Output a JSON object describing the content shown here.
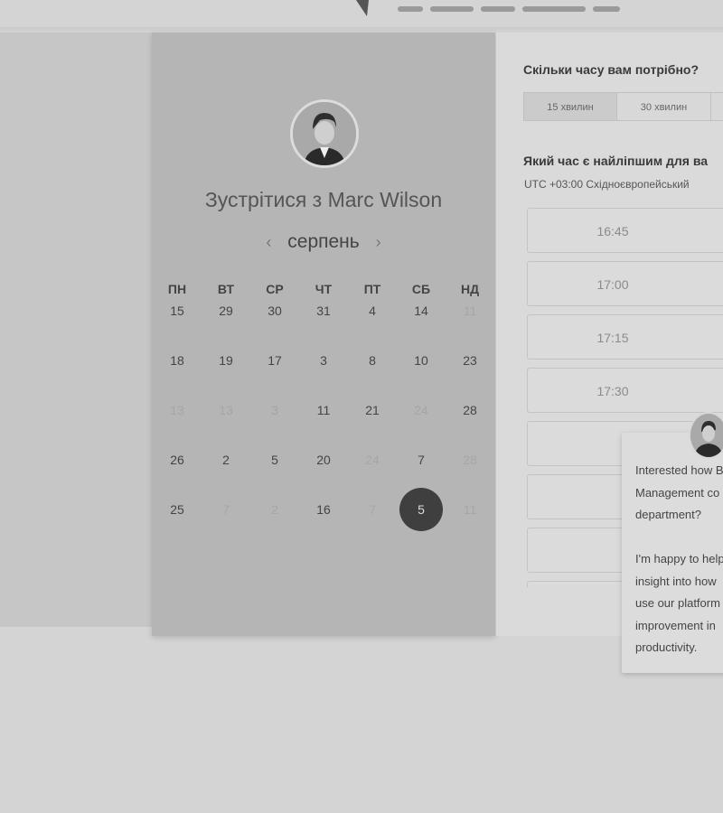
{
  "booking": {
    "title": "Зустрітися з Marc Wilson",
    "calendar": {
      "month": "серпень",
      "weekdays": [
        "ПН",
        "ВТ",
        "СР",
        "ЧТ",
        "ПТ",
        "СБ",
        "НД"
      ],
      "rows": [
        [
          {
            "n": "15"
          },
          {
            "n": "29"
          },
          {
            "n": "30"
          },
          {
            "n": "31"
          },
          {
            "n": "4"
          },
          {
            "n": "14"
          },
          {
            "n": "11",
            "muted": true
          }
        ],
        [
          {
            "n": "18"
          },
          {
            "n": "19"
          },
          {
            "n": "17"
          },
          {
            "n": "3"
          },
          {
            "n": "8"
          },
          {
            "n": "10"
          },
          {
            "n": "23"
          }
        ],
        [
          {
            "n": "13",
            "muted": true
          },
          {
            "n": "13",
            "muted": true
          },
          {
            "n": "3",
            "muted": true
          },
          {
            "n": "11"
          },
          {
            "n": "21"
          },
          {
            "n": "24",
            "muted": true
          },
          {
            "n": "28"
          }
        ],
        [
          {
            "n": "26"
          },
          {
            "n": "2"
          },
          {
            "n": "5"
          },
          {
            "n": "20"
          },
          {
            "n": "24",
            "muted": true
          },
          {
            "n": "7"
          },
          {
            "n": "28",
            "muted": true
          }
        ],
        [
          {
            "n": "25"
          },
          {
            "n": "7",
            "muted": true
          },
          {
            "n": "2",
            "muted": true
          },
          {
            "n": "16"
          },
          {
            "n": "7",
            "muted": true
          },
          {
            "n": "5",
            "selected": true
          },
          {
            "n": "11",
            "muted": true
          }
        ]
      ]
    }
  },
  "scheduler": {
    "duration_question": "Скільки часу вам потрібно?",
    "durations": [
      "15 хвилин",
      "30 хвилин"
    ],
    "time_question": "Який час є найліпшим для ва",
    "timezone": "UTC +03:00 Східноєвропейський",
    "slots": [
      "16:45",
      "17:00",
      "17:15",
      "17:30",
      "",
      "",
      "",
      ""
    ]
  },
  "chat": {
    "message": "Interested how B\nManagement co\ndepartment?\n\nI'm happy to help\ninsight into how\nuse our platform\nimprovement in\nproductivity."
  },
  "colors": {
    "selected_day_bg": "#3f3f3f",
    "calendar_panel_bg": "#b5b5b5"
  }
}
